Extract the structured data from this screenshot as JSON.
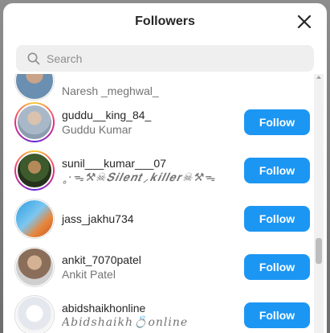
{
  "modal": {
    "title": "Followers",
    "search_placeholder": "Search"
  },
  "icons": {
    "close": "close-icon",
    "search": "search-icon"
  },
  "colors": {
    "follow_button": "#1c96f3",
    "story_ring": "#ee2a7b"
  },
  "followers": [
    {
      "username": "",
      "fullname": "Naresh _meghwal_",
      "button": ""
    },
    {
      "username": "guddu__king_84_",
      "fullname": "Guddu Kumar",
      "button": "Follow"
    },
    {
      "username": "sunil___kumar___07",
      "fullname": "˳·ᯓ⚒☠𝑺𝒊𝒍𝒆𝒏𝒕⸝𝒌𝒊𝒍𝒍𝒆𝒓☠⚒ᯓ",
      "button": "Follow"
    },
    {
      "username": "jass_jakhu734",
      "fullname": "",
      "button": "Follow"
    },
    {
      "username": "ankit_7070patel",
      "fullname": "Ankit Patel",
      "button": "Follow"
    },
    {
      "username": "abidshaikhonline",
      "fullname": "Abidshaikh💍online",
      "button": "Follow"
    }
  ]
}
